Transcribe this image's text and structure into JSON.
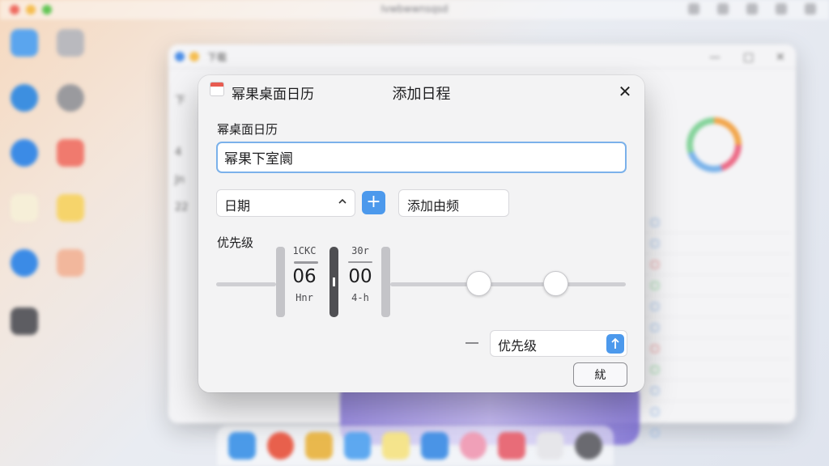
{
  "menubar": {
    "title": "Ivwbwwnsqsd"
  },
  "back_window": {
    "tab_label": "下载",
    "left_items": [
      "下",
      "",
      "4",
      "Jn",
      "22"
    ]
  },
  "dialog": {
    "app_name": "幂果桌面日历",
    "title": "添加日程",
    "title_section_label": "幂桌面日历",
    "title_input_value": "幂果下室阛",
    "date_select_label": "日期",
    "frequency_button_label": "添加由频",
    "priority_label": "优先级",
    "time_picker": {
      "hour_top": "1CKC",
      "hour": "06",
      "hour_bottom": "Hnr",
      "minute_top": "30r",
      "minute": "00",
      "minute_bottom": "4-h"
    },
    "priority_select_value": "优先级",
    "confirm_button_label": "紌"
  },
  "colors": {
    "accent": "#4c99ec",
    "focus_ring": "#7bb1ea",
    "dialog_bg": "#f3f3f4"
  }
}
